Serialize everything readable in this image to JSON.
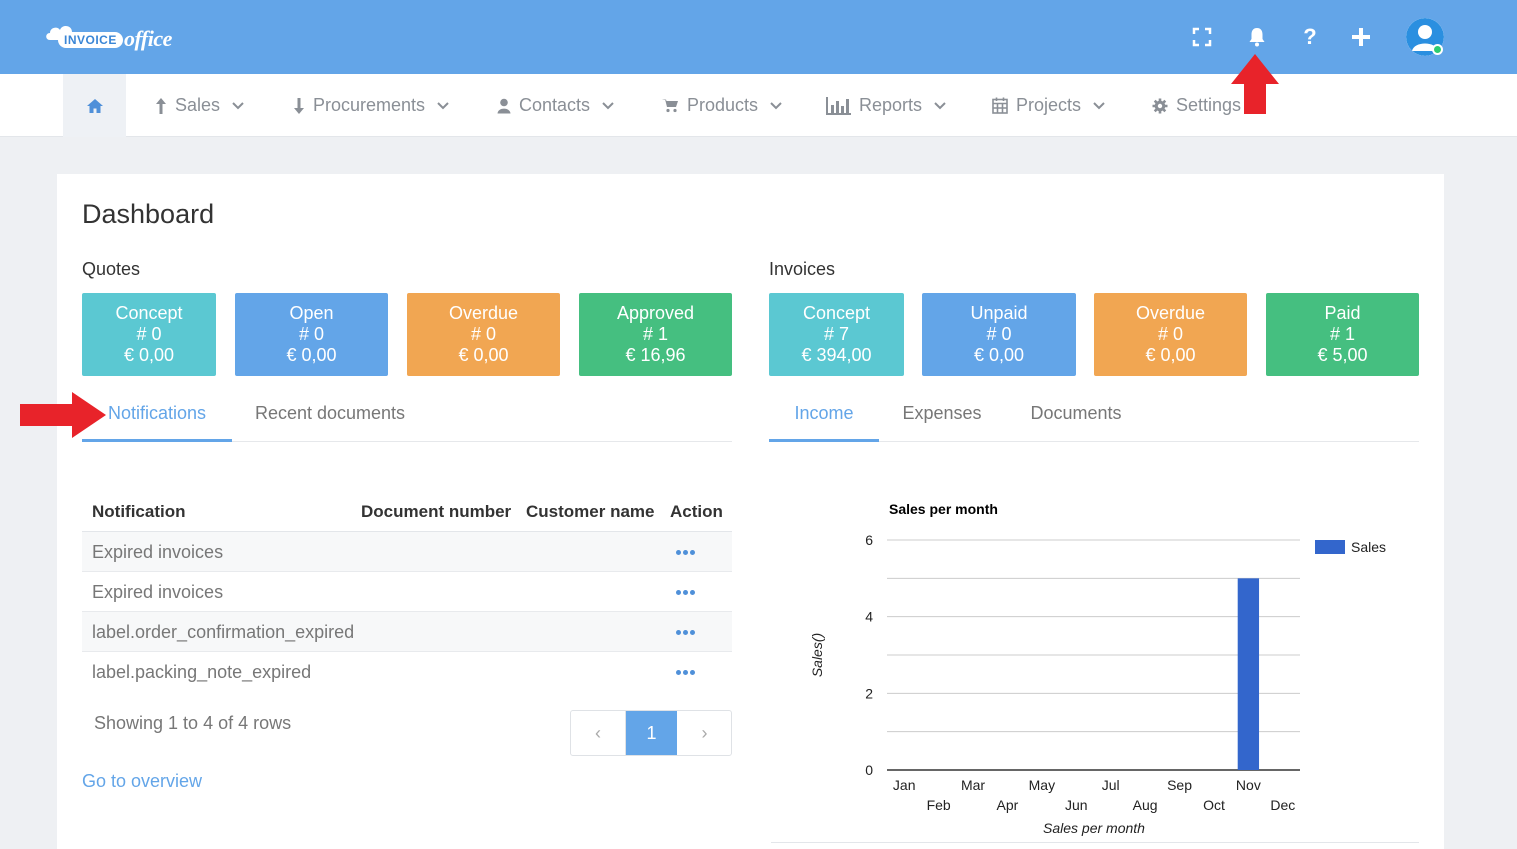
{
  "logo": {
    "badge": "INVOICE",
    "script": "office"
  },
  "topbar_icons": [
    "fullscreen-icon",
    "bell-icon",
    "help-icon",
    "plus-icon",
    "user-avatar-icon"
  ],
  "nav": {
    "home_icon": "home-icon",
    "items": [
      {
        "label": "Sales",
        "icon": "arrow-up-icon"
      },
      {
        "label": "Procurements",
        "icon": "arrow-down-icon"
      },
      {
        "label": "Contacts",
        "icon": "user-icon"
      },
      {
        "label": "Products",
        "icon": "cart-icon"
      },
      {
        "label": "Reports",
        "icon": "bar-chart-icon"
      },
      {
        "label": "Projects",
        "icon": "calendar-icon"
      },
      {
        "label": "Settings",
        "icon": "gear-icon"
      }
    ]
  },
  "page": {
    "title": "Dashboard"
  },
  "quotes": {
    "label": "Quotes",
    "tiles": [
      {
        "name": "Concept",
        "count": "# 0",
        "amount": "€ 0,00"
      },
      {
        "name": "Open",
        "count": "# 0",
        "amount": "€ 0,00"
      },
      {
        "name": "Overdue",
        "count": "# 0",
        "amount": "€ 0,00"
      },
      {
        "name": "Approved",
        "count": "# 1",
        "amount": "€ 16,96"
      }
    ]
  },
  "invoices": {
    "label": "Invoices",
    "tiles": [
      {
        "name": "Concept",
        "count": "# 7",
        "amount": "€ 394,00"
      },
      {
        "name": "Unpaid",
        "count": "# 0",
        "amount": "€ 0,00"
      },
      {
        "name": "Overdue",
        "count": "# 0",
        "amount": "€ 0,00"
      },
      {
        "name": "Paid",
        "count": "# 1",
        "amount": "€ 5,00"
      }
    ]
  },
  "left_tabs": [
    "Notifications",
    "Recent documents"
  ],
  "right_tabs": [
    "Income",
    "Expenses",
    "Documents"
  ],
  "table": {
    "headers": [
      "Notification",
      "Document number",
      "Customer name",
      "Action"
    ],
    "rows": [
      "Expired invoices",
      "Expired invoices",
      "label.order_confirmation_expired",
      "label.packing_note_expired"
    ],
    "action_icon": "ellipsis-icon"
  },
  "pagination": {
    "showing": "Showing 1 to 4 of 4 rows",
    "prev": "‹",
    "page": "1",
    "next": "›"
  },
  "overview_link": "Go to overview",
  "colors": {
    "topbar": "#63a5e8",
    "teal": "#5bc8d2",
    "blue": "#63a5e8",
    "orange": "#f1a652",
    "green": "#45bf80",
    "bar": "#3366cc",
    "annotation": "#e8232a"
  },
  "chart_data": {
    "type": "bar",
    "title": "Sales per month",
    "xlabel": "Sales per month",
    "ylabel": "Sales()",
    "categories": [
      "Jan",
      "Feb",
      "Mar",
      "Apr",
      "May",
      "Jun",
      "Jul",
      "Aug",
      "Sep",
      "Oct",
      "Nov",
      "Dec"
    ],
    "series": [
      {
        "name": "Sales",
        "values": [
          0,
          0,
          0,
          0,
          0,
          0,
          0,
          0,
          0,
          0,
          5,
          0
        ]
      }
    ],
    "ylim": [
      0,
      6
    ],
    "yticks": [
      0,
      2,
      4,
      6
    ],
    "grid": true,
    "legend": "right"
  }
}
